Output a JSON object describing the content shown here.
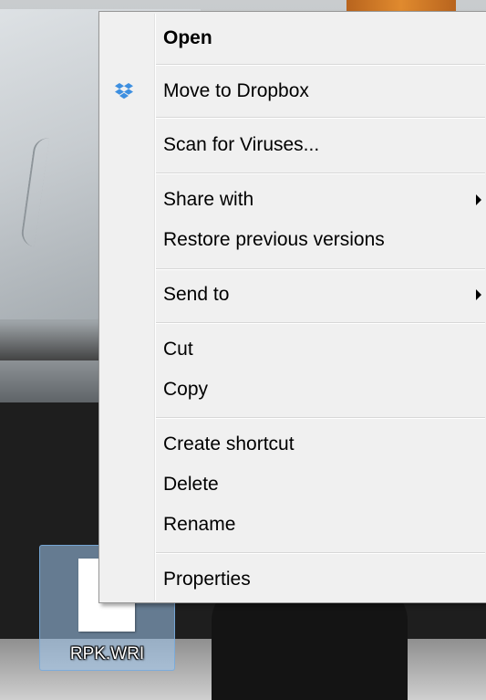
{
  "desktop_icon": {
    "label": "RPK.WRI"
  },
  "context_menu": {
    "open": "Open",
    "move_to_dropbox": "Move to Dropbox",
    "scan_for_viruses": "Scan for Viruses...",
    "share_with": "Share with",
    "restore_previous_versions": "Restore previous versions",
    "send_to": "Send to",
    "cut": "Cut",
    "copy": "Copy",
    "create_shortcut": "Create shortcut",
    "delete": "Delete",
    "rename": "Rename",
    "properties": "Properties"
  },
  "colors": {
    "menu_background": "#f0f0f0",
    "dropbox_blue": "#3d8fe0",
    "selection_blue": "#a0c8f0"
  },
  "icons": {
    "dropbox": "dropbox-icon",
    "submenu_arrow": "chevron-right-icon",
    "file": "file-icon"
  }
}
